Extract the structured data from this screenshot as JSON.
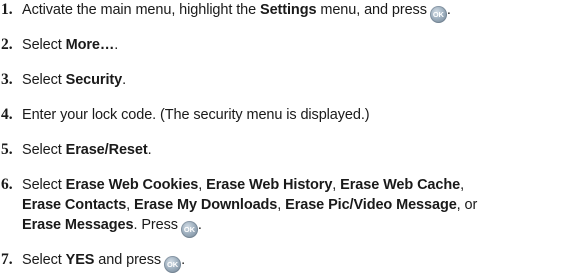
{
  "steps": [
    {
      "number": "1.",
      "parts": [
        {
          "t": "Activate the main menu, highlight the "
        },
        {
          "t": "Settings",
          "b": true
        },
        {
          "t": " menu, and press"
        },
        {
          "icon": "OK"
        },
        {
          "t": "."
        }
      ]
    },
    {
      "number": "2.",
      "parts": [
        {
          "t": "Select "
        },
        {
          "t": "More…",
          "b": true
        },
        {
          "t": "."
        }
      ]
    },
    {
      "number": "3.",
      "parts": [
        {
          "t": "Select "
        },
        {
          "t": "Security",
          "b": true
        },
        {
          "t": "."
        }
      ]
    },
    {
      "number": "4.",
      "parts": [
        {
          "t": "Enter your lock code. (The security menu is displayed.)"
        }
      ]
    },
    {
      "number": "5.",
      "parts": [
        {
          "t": "Select "
        },
        {
          "t": "Erase/Reset",
          "b": true
        },
        {
          "t": "."
        }
      ]
    },
    {
      "number": "6.",
      "parts": [
        {
          "t": "Select "
        },
        {
          "t": "Erase Web Cookies",
          "b": true
        },
        {
          "t": ", "
        },
        {
          "t": "Erase Web History",
          "b": true
        },
        {
          "t": ", "
        },
        {
          "t": "Erase Web Cache",
          "b": true
        },
        {
          "t": ","
        },
        {
          "br": true
        },
        {
          "t": "Erase Contacts",
          "b": true
        },
        {
          "t": ", "
        },
        {
          "t": "Erase My Downloads",
          "b": true
        },
        {
          "t": ", "
        },
        {
          "t": "Erase Pic/Video Message",
          "b": true
        },
        {
          "t": ", or"
        },
        {
          "br": true
        },
        {
          "t": "Erase Messages",
          "b": true
        },
        {
          "t": ". Press"
        },
        {
          "icon": "OK"
        },
        {
          "t": "."
        }
      ]
    },
    {
      "number": "7.",
      "parts": [
        {
          "t": "Select "
        },
        {
          "t": "YES",
          "b": true
        },
        {
          "t": " and press"
        },
        {
          "icon": "OK"
        },
        {
          "t": "."
        }
      ]
    }
  ],
  "icon_name": "ok-button-icon",
  "icon_color": "#8fa1b1"
}
